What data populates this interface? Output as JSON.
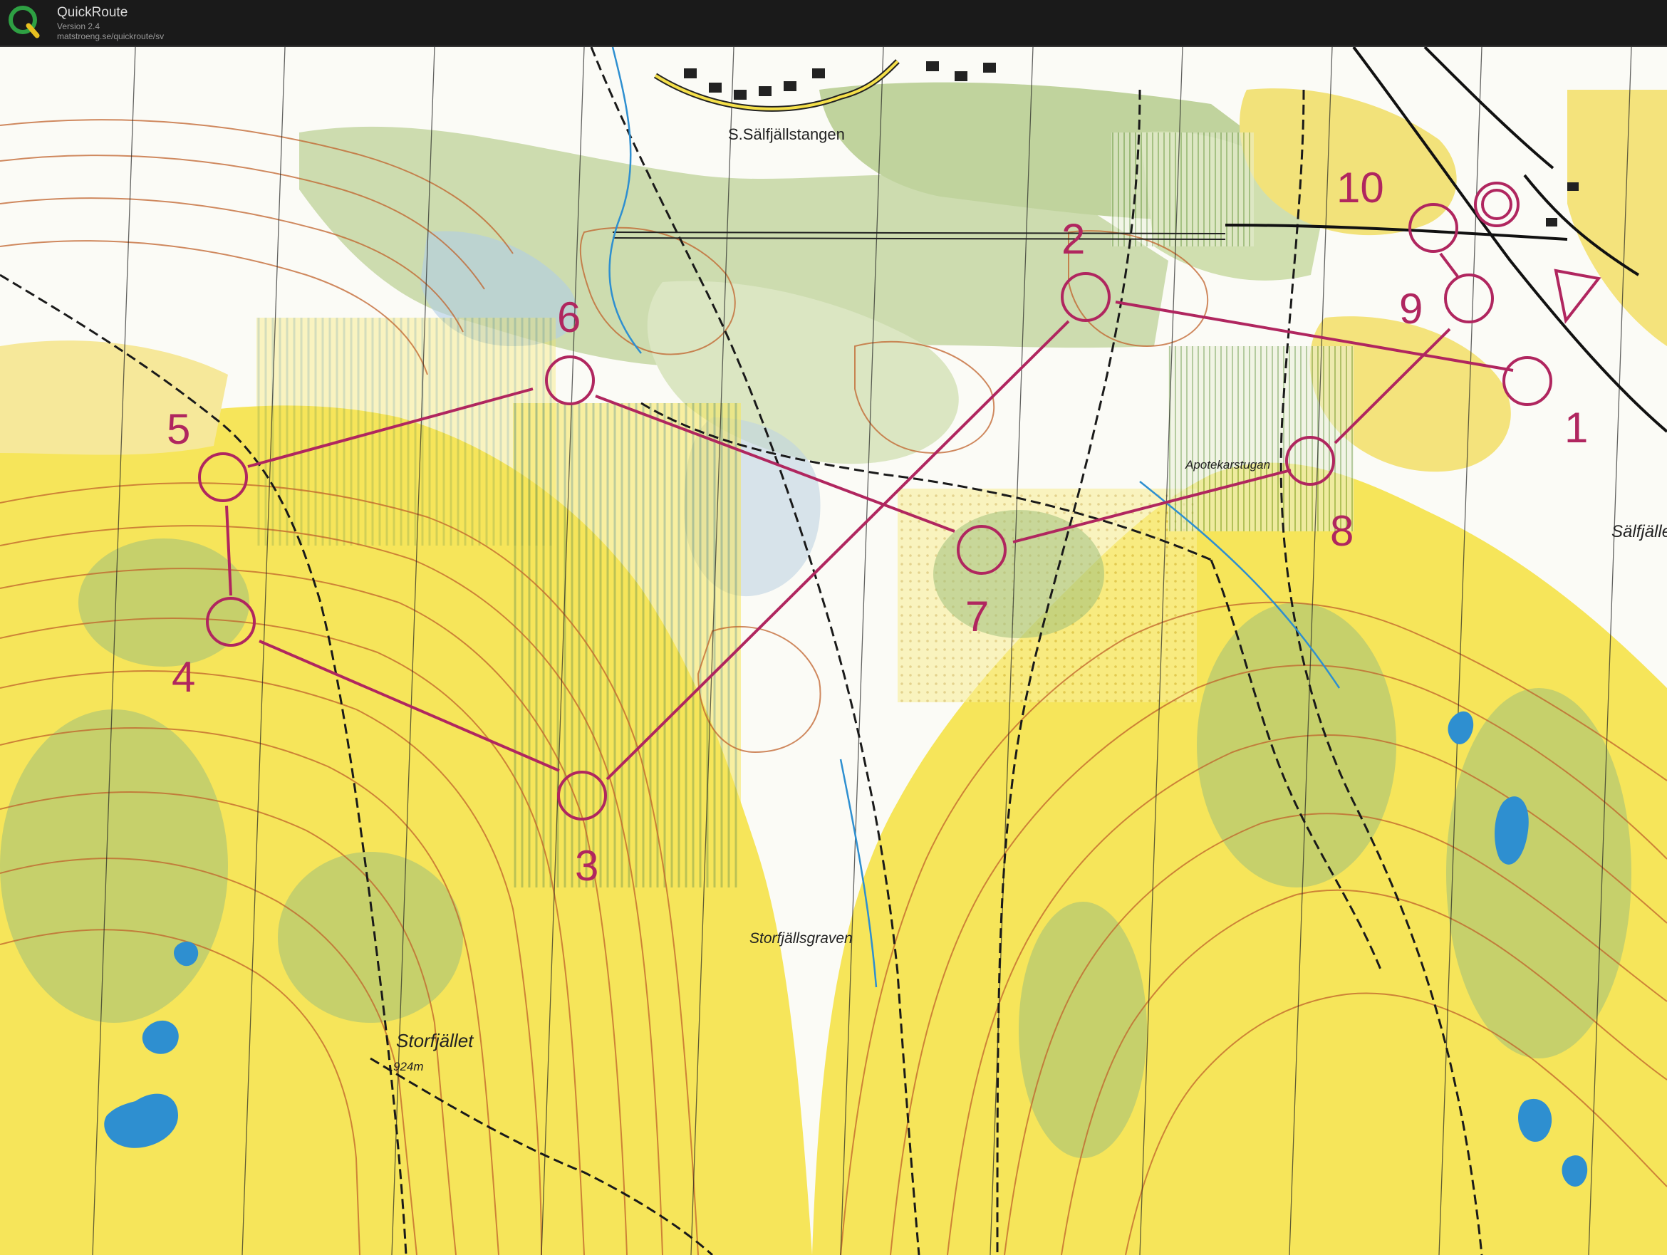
{
  "app": {
    "name": "QuickRoute",
    "version": "Version 2.4",
    "url": "matstroeng.se/quickroute/sv"
  },
  "map": {
    "places": {
      "s_salfjallstangen": "S.Sälfjällstangen",
      "apotekarstugan": "Apotekarstugan",
      "salfjallet": "Sälfjället",
      "storfjallsgraven": "Storfjällsgraven",
      "storfjallet": "Storfjället",
      "storfjallet_height": "924m"
    },
    "course": {
      "controls": [
        {
          "label": "1"
        },
        {
          "label": "2"
        },
        {
          "label": "3"
        },
        {
          "label": "4"
        },
        {
          "label": "5"
        },
        {
          "label": "6"
        },
        {
          "label": "7"
        },
        {
          "label": "8"
        },
        {
          "label": "9"
        },
        {
          "label": "10"
        }
      ],
      "colors": {
        "course": "#b0265f",
        "open_land": "#f6e55a",
        "forest": "#ffffff",
        "contour": "#c0622b",
        "water": "#2e8fd0"
      }
    }
  }
}
